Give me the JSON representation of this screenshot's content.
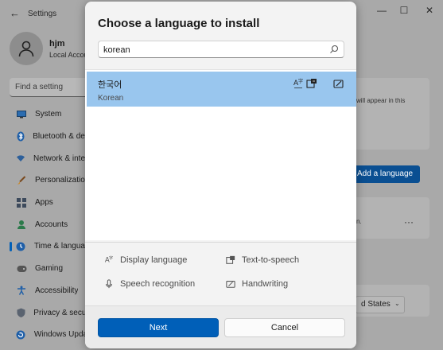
{
  "settings": {
    "title": "Settings",
    "user": {
      "name": "hjm",
      "account_type": "Local Account"
    },
    "find_placeholder": "Find a setting",
    "nav": [
      {
        "label": "System",
        "icon": "monitor-icon"
      },
      {
        "label": "Bluetooth & devices",
        "icon": "bluetooth-icon"
      },
      {
        "label": "Network & internet",
        "icon": "wifi-icon"
      },
      {
        "label": "Personalization",
        "icon": "brush-icon"
      },
      {
        "label": "Apps",
        "icon": "apps-icon"
      },
      {
        "label": "Accounts",
        "icon": "person-icon"
      },
      {
        "label": "Time & language",
        "icon": "globe-clock-icon",
        "active": true
      },
      {
        "label": "Gaming",
        "icon": "gamepad-icon"
      },
      {
        "label": "Accessibility",
        "icon": "accessibility-icon"
      },
      {
        "label": "Privacy & security",
        "icon": "shield-icon"
      },
      {
        "label": "Windows Update",
        "icon": "update-icon"
      }
    ],
    "right": {
      "partial_text_1": "will appear in this",
      "partial_text_2": "n.",
      "add_language_label": "Add a language",
      "more_label": "···",
      "region_value": "d States"
    }
  },
  "dialog": {
    "title": "Choose a language to install",
    "search_value": "korean",
    "results": [
      {
        "native": "한국어",
        "english": "Korean",
        "selected": true,
        "icons": [
          "display-language-icon",
          "text-to-speech-icon",
          "handwriting-icon"
        ]
      }
    ],
    "features": [
      {
        "label": "Display language",
        "icon": "display-language-icon"
      },
      {
        "label": "Text-to-speech",
        "icon": "text-to-speech-icon"
      },
      {
        "label": "Speech recognition",
        "icon": "microphone-icon"
      },
      {
        "label": "Handwriting",
        "icon": "handwriting-icon"
      }
    ],
    "next_label": "Next",
    "cancel_label": "Cancel"
  },
  "colors": {
    "accent": "#005fb8",
    "selected_row": "#99c6ee",
    "dim_bg": "#a9a9a9"
  }
}
